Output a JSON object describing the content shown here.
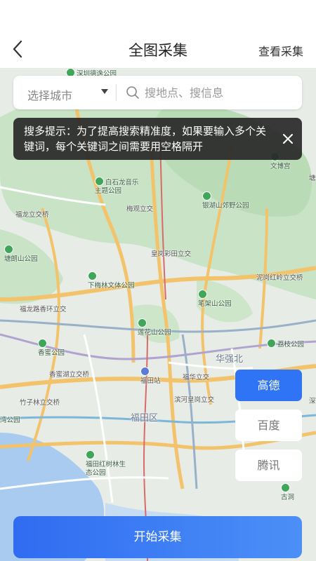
{
  "header": {
    "title": "全图采集",
    "view_link": "查看采集"
  },
  "search": {
    "city_label": "选择城市",
    "placeholder": "搜地点、搜信息"
  },
  "tip": {
    "text": "搜多提示：为了提高搜索精准度，如果要输入多个关键词，每个关键词之间需要用空格隔开"
  },
  "map": {
    "labels": {
      "shenzhen_deyu": "深圳德逸公园",
      "wenchang": "文博宫",
      "baishilong": "白石龙音乐主题公园",
      "meiguan": "梅观立交",
      "yinhu": "银湖山郊野公园",
      "fulong": "福龙立交桥",
      "huanggang_caitian": "皇岗彩田立交",
      "tanglang": "塘朗山公园",
      "nigang": "泥岗红岭立交桥",
      "xiameilin": "下梅林文体公园",
      "fulonglu": "福龙路香环立交",
      "bijiashan": "笔架山公园",
      "lianhua": "莲花山公园",
      "xiangmi": "香蜜公园",
      "huaqiangbei": "华强北",
      "lizhi": "荔枝公园",
      "xiangmihu": "香蜜湖立交桥",
      "futian_station": "福田站",
      "fuhua": "福华立交",
      "zhuzilin": "竹子林立交桥",
      "binhe": "滨河皇岗立交",
      "shen": "深",
      "wan": "湾公园",
      "futian_district": "福田区",
      "hongshulin": "福田红树林生态公园",
      "gudong": "古洞",
      "tang": "塘"
    }
  },
  "providers": {
    "gaode": "高德",
    "baidu": "百度",
    "tencent": "腾讯"
  },
  "actions": {
    "start": "开始采集"
  },
  "colors": {
    "accent": "#2f74f4",
    "park": "#3fa65a",
    "tip_bg": "#282828"
  }
}
